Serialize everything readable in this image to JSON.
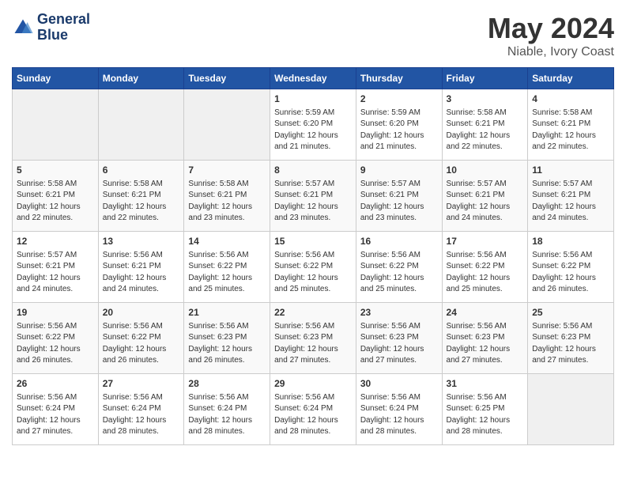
{
  "header": {
    "logo_line1": "General",
    "logo_line2": "Blue",
    "month": "May 2024",
    "location": "Niable, Ivory Coast"
  },
  "weekdays": [
    "Sunday",
    "Monday",
    "Tuesday",
    "Wednesday",
    "Thursday",
    "Friday",
    "Saturday"
  ],
  "weeks": [
    [
      {
        "day": "",
        "info": ""
      },
      {
        "day": "",
        "info": ""
      },
      {
        "day": "",
        "info": ""
      },
      {
        "day": "1",
        "info": "Sunrise: 5:59 AM\nSunset: 6:20 PM\nDaylight: 12 hours and 21 minutes."
      },
      {
        "day": "2",
        "info": "Sunrise: 5:59 AM\nSunset: 6:20 PM\nDaylight: 12 hours and 21 minutes."
      },
      {
        "day": "3",
        "info": "Sunrise: 5:58 AM\nSunset: 6:21 PM\nDaylight: 12 hours and 22 minutes."
      },
      {
        "day": "4",
        "info": "Sunrise: 5:58 AM\nSunset: 6:21 PM\nDaylight: 12 hours and 22 minutes."
      }
    ],
    [
      {
        "day": "5",
        "info": "Sunrise: 5:58 AM\nSunset: 6:21 PM\nDaylight: 12 hours and 22 minutes."
      },
      {
        "day": "6",
        "info": "Sunrise: 5:58 AM\nSunset: 6:21 PM\nDaylight: 12 hours and 22 minutes."
      },
      {
        "day": "7",
        "info": "Sunrise: 5:58 AM\nSunset: 6:21 PM\nDaylight: 12 hours and 23 minutes."
      },
      {
        "day": "8",
        "info": "Sunrise: 5:57 AM\nSunset: 6:21 PM\nDaylight: 12 hours and 23 minutes."
      },
      {
        "day": "9",
        "info": "Sunrise: 5:57 AM\nSunset: 6:21 PM\nDaylight: 12 hours and 23 minutes."
      },
      {
        "day": "10",
        "info": "Sunrise: 5:57 AM\nSunset: 6:21 PM\nDaylight: 12 hours and 24 minutes."
      },
      {
        "day": "11",
        "info": "Sunrise: 5:57 AM\nSunset: 6:21 PM\nDaylight: 12 hours and 24 minutes."
      }
    ],
    [
      {
        "day": "12",
        "info": "Sunrise: 5:57 AM\nSunset: 6:21 PM\nDaylight: 12 hours and 24 minutes."
      },
      {
        "day": "13",
        "info": "Sunrise: 5:56 AM\nSunset: 6:21 PM\nDaylight: 12 hours and 24 minutes."
      },
      {
        "day": "14",
        "info": "Sunrise: 5:56 AM\nSunset: 6:22 PM\nDaylight: 12 hours and 25 minutes."
      },
      {
        "day": "15",
        "info": "Sunrise: 5:56 AM\nSunset: 6:22 PM\nDaylight: 12 hours and 25 minutes."
      },
      {
        "day": "16",
        "info": "Sunrise: 5:56 AM\nSunset: 6:22 PM\nDaylight: 12 hours and 25 minutes."
      },
      {
        "day": "17",
        "info": "Sunrise: 5:56 AM\nSunset: 6:22 PM\nDaylight: 12 hours and 25 minutes."
      },
      {
        "day": "18",
        "info": "Sunrise: 5:56 AM\nSunset: 6:22 PM\nDaylight: 12 hours and 26 minutes."
      }
    ],
    [
      {
        "day": "19",
        "info": "Sunrise: 5:56 AM\nSunset: 6:22 PM\nDaylight: 12 hours and 26 minutes."
      },
      {
        "day": "20",
        "info": "Sunrise: 5:56 AM\nSunset: 6:22 PM\nDaylight: 12 hours and 26 minutes."
      },
      {
        "day": "21",
        "info": "Sunrise: 5:56 AM\nSunset: 6:23 PM\nDaylight: 12 hours and 26 minutes."
      },
      {
        "day": "22",
        "info": "Sunrise: 5:56 AM\nSunset: 6:23 PM\nDaylight: 12 hours and 27 minutes."
      },
      {
        "day": "23",
        "info": "Sunrise: 5:56 AM\nSunset: 6:23 PM\nDaylight: 12 hours and 27 minutes."
      },
      {
        "day": "24",
        "info": "Sunrise: 5:56 AM\nSunset: 6:23 PM\nDaylight: 12 hours and 27 minutes."
      },
      {
        "day": "25",
        "info": "Sunrise: 5:56 AM\nSunset: 6:23 PM\nDaylight: 12 hours and 27 minutes."
      }
    ],
    [
      {
        "day": "26",
        "info": "Sunrise: 5:56 AM\nSunset: 6:24 PM\nDaylight: 12 hours and 27 minutes."
      },
      {
        "day": "27",
        "info": "Sunrise: 5:56 AM\nSunset: 6:24 PM\nDaylight: 12 hours and 28 minutes."
      },
      {
        "day": "28",
        "info": "Sunrise: 5:56 AM\nSunset: 6:24 PM\nDaylight: 12 hours and 28 minutes."
      },
      {
        "day": "29",
        "info": "Sunrise: 5:56 AM\nSunset: 6:24 PM\nDaylight: 12 hours and 28 minutes."
      },
      {
        "day": "30",
        "info": "Sunrise: 5:56 AM\nSunset: 6:24 PM\nDaylight: 12 hours and 28 minutes."
      },
      {
        "day": "31",
        "info": "Sunrise: 5:56 AM\nSunset: 6:25 PM\nDaylight: 12 hours and 28 minutes."
      },
      {
        "day": "",
        "info": ""
      }
    ]
  ]
}
